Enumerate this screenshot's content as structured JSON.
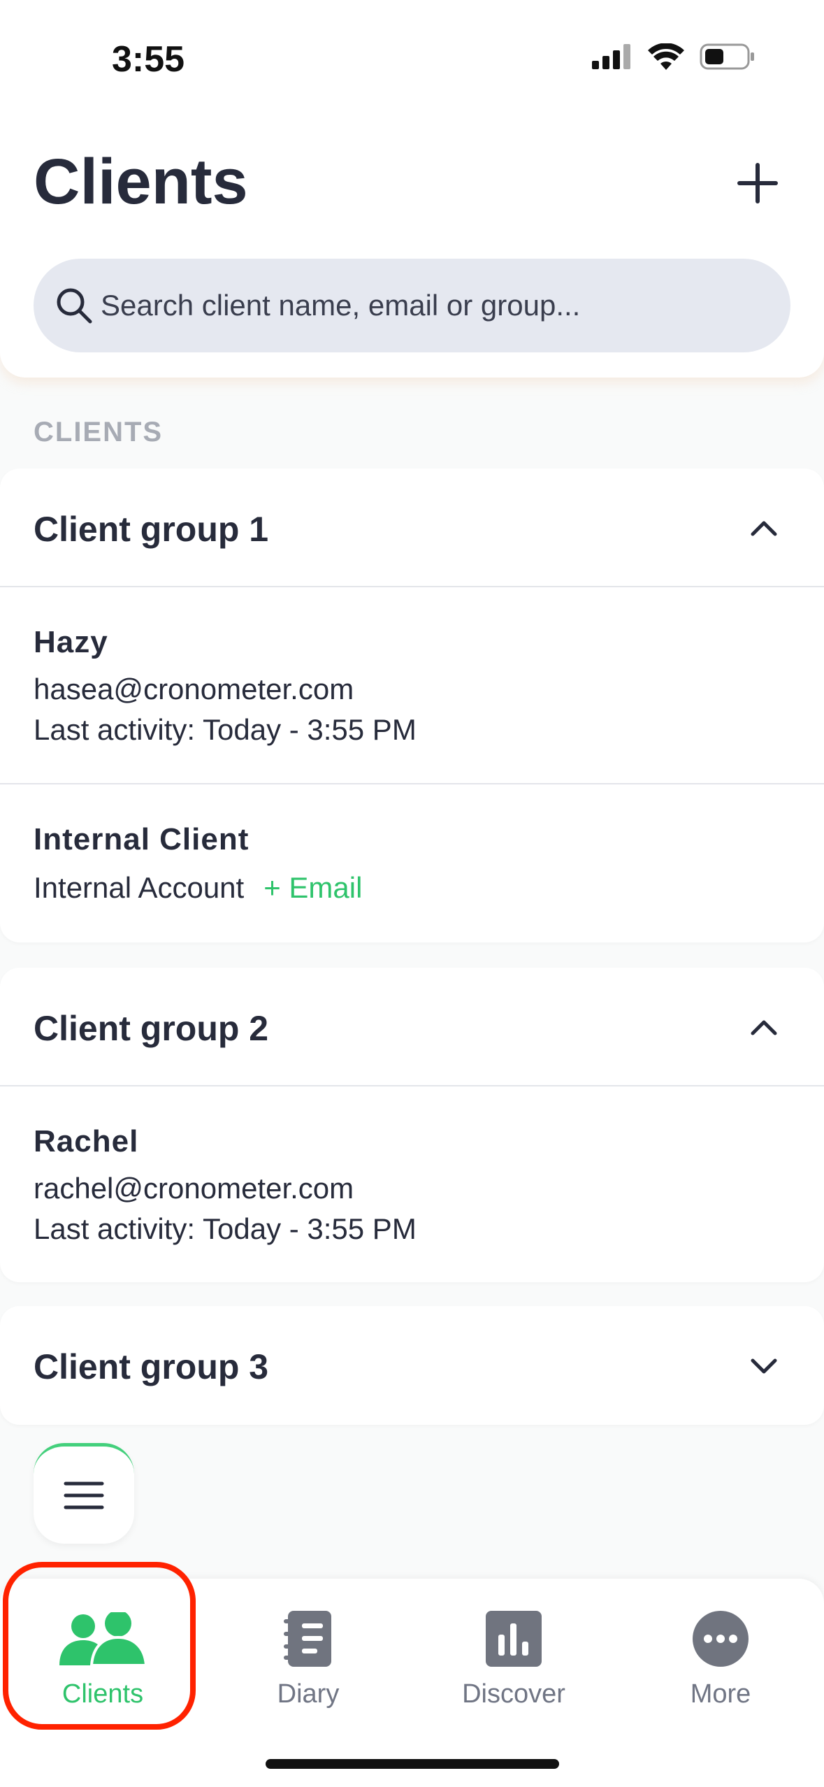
{
  "status_bar": {
    "time": "3:55"
  },
  "header": {
    "title": "Clients",
    "search_placeholder": "Search client name, email or group..."
  },
  "section_label": "CLIENTS",
  "groups": [
    {
      "title": "Client group 1",
      "expanded": true,
      "clients": [
        {
          "name": "Hazy",
          "email": "hasea@cronometer.com",
          "last_activity": "Last activity: Today - 3:55 PM"
        },
        {
          "name": "Internal Client",
          "account": "Internal Account",
          "email_action": "+ Email"
        }
      ]
    },
    {
      "title": "Client group 2",
      "expanded": true,
      "clients": [
        {
          "name": "Rachel",
          "email": "rachel@cronometer.com",
          "last_activity": "Last activity: Today - 3:55 PM"
        }
      ]
    },
    {
      "title": "Client group 3",
      "expanded": false,
      "clients": []
    }
  ],
  "tab_bar": {
    "tabs": [
      {
        "label": "Clients",
        "icon": "people-icon",
        "active": true
      },
      {
        "label": "Diary",
        "icon": "notebook-icon",
        "active": false
      },
      {
        "label": "Discover",
        "icon": "bar-chart-icon",
        "active": false
      },
      {
        "label": "More",
        "icon": "more-dots-icon",
        "active": false
      }
    ]
  },
  "colors": {
    "accent": "#2ec36b",
    "text": "#272b3b",
    "search_bg": "#e5e8f0",
    "highlight": "#ff2200"
  }
}
